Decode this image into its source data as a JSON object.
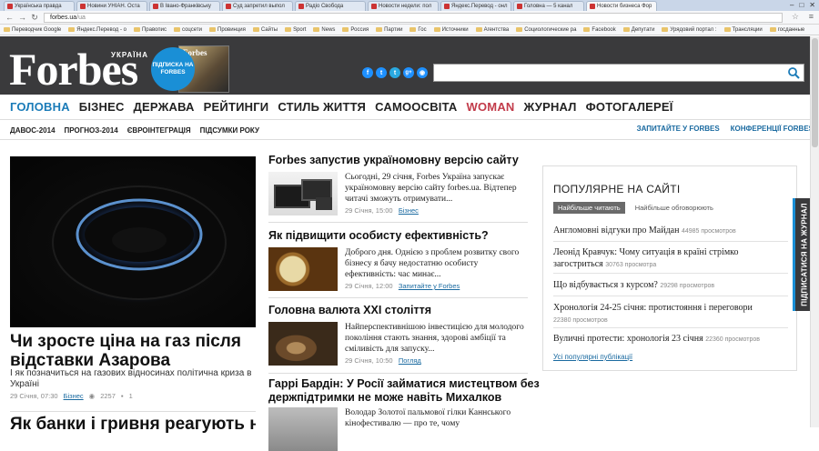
{
  "browser": {
    "tabs": [
      {
        "label": "Українська правда",
        "active": false
      },
      {
        "label": "Новини УНІАН. Оста",
        "active": false
      },
      {
        "label": "В Івано-Франківську",
        "active": false
      },
      {
        "label": "Суд запретил выпол",
        "active": false
      },
      {
        "label": "Радіо Свобода",
        "active": false
      },
      {
        "label": "Новости недели: пол",
        "active": false
      },
      {
        "label": "Яндекс.Перевод - онл",
        "active": false
      },
      {
        "label": "Головна — 5 канал",
        "active": false
      },
      {
        "label": "Новости бизнеса Фор",
        "active": true
      }
    ],
    "url_host": "forbes.ua",
    "url_path": "/ua",
    "bookmarks": [
      "Переводчик Google",
      "Яндекс.Перевод - о",
      "Правопис",
      "соцсети",
      "Провинция",
      "Сайты",
      "Sport",
      "News",
      "Россия",
      "Партии",
      "Гос",
      "Источники",
      "Агентства",
      "Социологические ра",
      "Facebook",
      "Депутати",
      "Урядовий портал :",
      "Трансляции",
      "госданные"
    ]
  },
  "header": {
    "logo": "Forbes",
    "edition": "УКРАЇНА",
    "subscribe": "ПІДПИСКА НА FORBES",
    "magazine_title": "Forbes",
    "socials": [
      "f",
      "t",
      "t",
      "g+",
      "rss"
    ],
    "search_placeholder": ""
  },
  "nav": {
    "main": [
      "ГОЛОВНА",
      "БІЗНЕС",
      "ДЕРЖАВА",
      "РЕЙТИНГИ",
      "СТИЛЬ ЖИТТЯ",
      "САМООСВІТА",
      "WOMAN",
      "ЖУРНАЛ",
      "ФОТОГАЛЕРЕЇ"
    ],
    "sub": [
      "ДАВОС-2014",
      "ПРОГНОЗ-2014",
      "ЄВРОІНТЕГРАЦІЯ",
      "ПІДСУМКИ РОКУ"
    ],
    "sub_right": [
      "ЗАПИТАЙТЕ У FORBES",
      "КОНФЕРЕНЦІЇ FORBES"
    ]
  },
  "feature": {
    "title": "Чи зросте ціна на газ після відставки Азарова",
    "desc": "І як позначиться на газових відносинах політична криза в Україні",
    "date": "29 Січня, 07:30",
    "category": "Бізнес",
    "views": "2257",
    "comments": "1",
    "next_title": "Як банки і гривня реагують на"
  },
  "articles": [
    {
      "title": "Forbes запустив україномовну версію сайту",
      "text": "Сьогодні, 29 січня, Forbes Україна запускає україномовну версію сайту forbes.ua. Відтепер читачі зможуть отримувати...",
      "date": "29 Січня, 15:00",
      "category": "Бізнес"
    },
    {
      "title": "Як підвищити особисту ефективність?",
      "text": "Доброго дня. Однією з проблем розвитку свого бізнесу я бачу недостатню особисту ефективність: час минає...",
      "date": "29 Січня, 12:00",
      "category": "Запитайте у Forbes"
    },
    {
      "title": "Головна валюта XXI століття",
      "text": "Найперспективнішою інвестицією для молодого покоління стають знання, здорові амбіції та сміливість для запуску...",
      "date": "29 Січня, 10:50",
      "category": "Погляд"
    },
    {
      "title": "Гаррі Бардін: У Росії займатися мистецтвом без",
      "title2": "держпідтримки не може навіть Михалков",
      "text": "Володар Золотої пальмової гілки Каннського кінофестивалю — про те, чому",
      "date": "",
      "category": ""
    }
  ],
  "popular": {
    "title": "ПОПУЛЯРНЕ НА САЙТІ",
    "tab_active": "Найбільше читають",
    "tab_other": "Найбільше обговорюють",
    "items": [
      {
        "text": "Англомовні відгуки про Майдан",
        "views": "44985 просмотров"
      },
      {
        "text": "Леонід Кравчук: Чому ситуація в країні стрімко загостриться",
        "views": "30763 просмотра"
      },
      {
        "text": "Що відбувається з курсом?",
        "views": "29298 просмотров"
      },
      {
        "text": "Хронологія 24-25 січня: протистояння і переговори",
        "views": "22380 просмотров"
      },
      {
        "text": "Вуличні протести: хронологія 23 січня",
        "views": "22360 просмотров"
      }
    ],
    "all_link": "Усі популярні публікації"
  },
  "side_tab": "ПІДПИСАТИСЯ НА ЖУРНАЛ"
}
